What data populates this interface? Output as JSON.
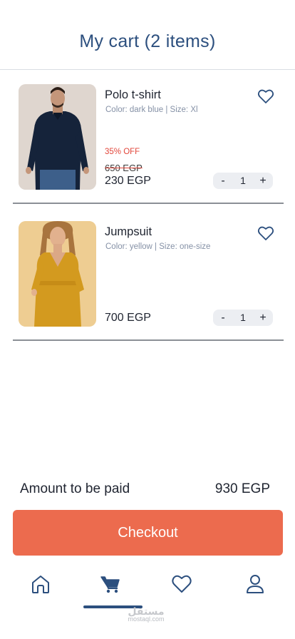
{
  "header": {
    "title": "My cart (2 items)"
  },
  "cart": {
    "items": [
      {
        "name": "Polo t-shirt",
        "meta": "Color: dark blue | Size: Xl",
        "discount": "35% OFF",
        "old_price": "650 EGP",
        "price": "230 EGP",
        "quantity": "1",
        "minus": "-",
        "plus": "+"
      },
      {
        "name": "Jumpsuit",
        "meta": "Color: yellow | Size: one-size",
        "price": "700 EGP",
        "quantity": "1",
        "minus": "-",
        "plus": "+"
      }
    ]
  },
  "summary": {
    "label": "Amount to be paid",
    "value": "930 EGP"
  },
  "checkout": {
    "label": "Checkout"
  },
  "nav": {
    "items": [
      {
        "icon": "home-icon"
      },
      {
        "icon": "cart-icon",
        "active": true
      },
      {
        "icon": "heart-icon"
      },
      {
        "icon": "user-icon"
      }
    ]
  },
  "watermark": {
    "logo": "مستقل",
    "text": "mostaql.com"
  },
  "colors": {
    "title": "#2c4f7e",
    "accent": "#ec6b4e",
    "discount": "#e2463a",
    "meta": "#8591a6"
  }
}
